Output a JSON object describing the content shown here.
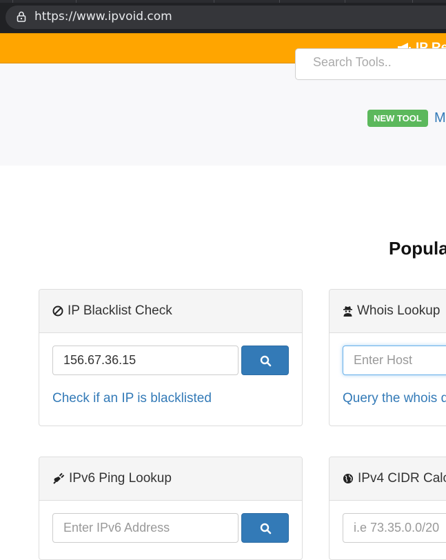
{
  "browser": {
    "url": "https://www.ipvoid.com"
  },
  "topbar": {
    "text": "IP Rep"
  },
  "search": {
    "placeholder": "Search Tools.."
  },
  "hero": {
    "badge": "NEW TOOL",
    "link_text": "M"
  },
  "section": {
    "heading": "Popula"
  },
  "panels": {
    "blacklist": {
      "title": "IP Blacklist Check",
      "input_value": "156.67.36.15",
      "link": "Check if an IP is blacklisted"
    },
    "whois": {
      "title": "Whois Lookup",
      "placeholder": "Enter Host",
      "link": "Query the whois d"
    },
    "ipv6ping": {
      "title": "IPv6 Ping Lookup",
      "placeholder": "Enter IPv6 Address"
    },
    "cidr": {
      "title": "IPv4 CIDR Calcu",
      "placeholder": "i.e 73.35.0.0/20"
    }
  },
  "colors": {
    "orange": "#ffa500",
    "link": "#337ab7",
    "badge": "#5cb85c",
    "button": "#337ab7"
  }
}
